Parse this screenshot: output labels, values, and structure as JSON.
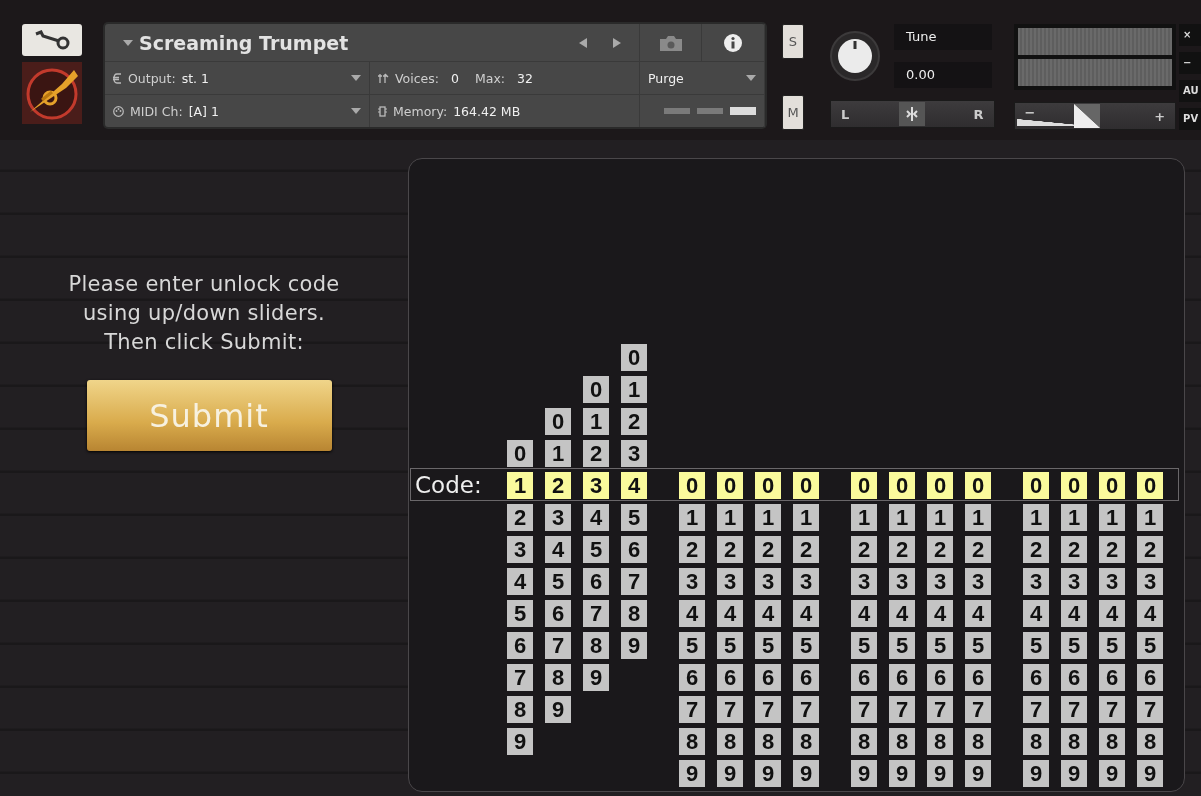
{
  "instrument": {
    "title": "Screaming Trumpet",
    "output_label": "Output:",
    "output_value": "st. 1",
    "voices_label": "Voices:",
    "voices_value": "0",
    "max_label": "Max:",
    "max_value": "32",
    "purge": "Purge",
    "midi_label": "MIDI Ch:",
    "midi_value": "[A] 1",
    "memory_label": "Memory:",
    "memory_value": "164.42 MB"
  },
  "solo_button": "S",
  "mute_button": "M",
  "tune": {
    "label": "Tune",
    "value": "0.00"
  },
  "pan": {
    "left": "L",
    "right": "R",
    "level": 0.5
  },
  "volume": {
    "minus": "−",
    "plus": "+",
    "level": 0.45
  },
  "side_buttons": [
    "×",
    "−",
    "AU",
    "PV"
  ],
  "unlock": {
    "instructions": "Please enter unlock code\nusing up/down sliders.\nThen click Submit:",
    "submit": "Submit"
  },
  "code": {
    "label": "Code:",
    "groups": [
      {
        "columns": [
          {
            "digits": [
              {
                "label": "0",
                "selected": false
              },
              {
                "label": "1",
                "selected": true
              },
              {
                "label": "2",
                "selected": false
              },
              {
                "label": "3",
                "selected": false
              },
              {
                "label": "4",
                "selected": false
              },
              {
                "label": "5",
                "selected": false
              },
              {
                "label": "6",
                "selected": false
              },
              {
                "label": "7",
                "selected": false
              },
              {
                "label": "8",
                "selected": false
              },
              {
                "label": "9",
                "selected": false
              }
            ]
          },
          {
            "digits": [
              {
                "label": "0",
                "selected": false
              },
              {
                "label": "1",
                "selected": false
              },
              {
                "label": "2",
                "selected": true
              },
              {
                "label": "3",
                "selected": false
              },
              {
                "label": "4",
                "selected": false
              },
              {
                "label": "5",
                "selected": false
              },
              {
                "label": "6",
                "selected": false
              },
              {
                "label": "7",
                "selected": false
              },
              {
                "label": "8",
                "selected": false
              },
              {
                "label": "9",
                "selected": false
              }
            ]
          },
          {
            "digits": [
              {
                "label": "0",
                "selected": false
              },
              {
                "label": "1",
                "selected": false
              },
              {
                "label": "2",
                "selected": false
              },
              {
                "label": "3",
                "selected": true
              },
              {
                "label": "4",
                "selected": false
              },
              {
                "label": "5",
                "selected": false
              },
              {
                "label": "6",
                "selected": false
              },
              {
                "label": "7",
                "selected": false
              },
              {
                "label": "8",
                "selected": false
              },
              {
                "label": "9",
                "selected": false
              }
            ]
          },
          {
            "digits": [
              {
                "label": "0",
                "selected": false
              },
              {
                "label": "1",
                "selected": false
              },
              {
                "label": "2",
                "selected": false
              },
              {
                "label": "3",
                "selected": false
              },
              {
                "label": "4",
                "selected": true
              },
              {
                "label": "5",
                "selected": false
              },
              {
                "label": "6",
                "selected": false
              },
              {
                "label": "7",
                "selected": false
              },
              {
                "label": "8",
                "selected": false
              },
              {
                "label": "9",
                "selected": false
              }
            ]
          }
        ]
      },
      {
        "columns": [
          {
            "digits": [
              {
                "label": "0",
                "selected": true
              },
              {
                "label": "1",
                "selected": false
              },
              {
                "label": "2",
                "selected": false
              },
              {
                "label": "3",
                "selected": false
              },
              {
                "label": "4",
                "selected": false
              },
              {
                "label": "5",
                "selected": false
              },
              {
                "label": "6",
                "selected": false
              },
              {
                "label": "7",
                "selected": false
              },
              {
                "label": "8",
                "selected": false
              },
              {
                "label": "9",
                "selected": false
              }
            ]
          },
          {
            "digits": [
              {
                "label": "0",
                "selected": true
              },
              {
                "label": "1",
                "selected": false
              },
              {
                "label": "2",
                "selected": false
              },
              {
                "label": "3",
                "selected": false
              },
              {
                "label": "4",
                "selected": false
              },
              {
                "label": "5",
                "selected": false
              },
              {
                "label": "6",
                "selected": false
              },
              {
                "label": "7",
                "selected": false
              },
              {
                "label": "8",
                "selected": false
              },
              {
                "label": "9",
                "selected": false
              }
            ]
          },
          {
            "digits": [
              {
                "label": "0",
                "selected": true
              },
              {
                "label": "1",
                "selected": false
              },
              {
                "label": "2",
                "selected": false
              },
              {
                "label": "3",
                "selected": false
              },
              {
                "label": "4",
                "selected": false
              },
              {
                "label": "5",
                "selected": false
              },
              {
                "label": "6",
                "selected": false
              },
              {
                "label": "7",
                "selected": false
              },
              {
                "label": "8",
                "selected": false
              },
              {
                "label": "9",
                "selected": false
              }
            ]
          },
          {
            "digits": [
              {
                "label": "0",
                "selected": true
              },
              {
                "label": "1",
                "selected": false
              },
              {
                "label": "2",
                "selected": false
              },
              {
                "label": "3",
                "selected": false
              },
              {
                "label": "4",
                "selected": false
              },
              {
                "label": "5",
                "selected": false
              },
              {
                "label": "6",
                "selected": false
              },
              {
                "label": "7",
                "selected": false
              },
              {
                "label": "8",
                "selected": false
              },
              {
                "label": "9",
                "selected": false
              }
            ]
          }
        ]
      },
      {
        "columns": [
          {
            "digits": [
              {
                "label": "0",
                "selected": true
              },
              {
                "label": "1",
                "selected": false
              },
              {
                "label": "2",
                "selected": false
              },
              {
                "label": "3",
                "selected": false
              },
              {
                "label": "4",
                "selected": false
              },
              {
                "label": "5",
                "selected": false
              },
              {
                "label": "6",
                "selected": false
              },
              {
                "label": "7",
                "selected": false
              },
              {
                "label": "8",
                "selected": false
              },
              {
                "label": "9",
                "selected": false
              }
            ]
          },
          {
            "digits": [
              {
                "label": "0",
                "selected": true
              },
              {
                "label": "1",
                "selected": false
              },
              {
                "label": "2",
                "selected": false
              },
              {
                "label": "3",
                "selected": false
              },
              {
                "label": "4",
                "selected": false
              },
              {
                "label": "5",
                "selected": false
              },
              {
                "label": "6",
                "selected": false
              },
              {
                "label": "7",
                "selected": false
              },
              {
                "label": "8",
                "selected": false
              },
              {
                "label": "9",
                "selected": false
              }
            ]
          },
          {
            "digits": [
              {
                "label": "0",
                "selected": true
              },
              {
                "label": "1",
                "selected": false
              },
              {
                "label": "2",
                "selected": false
              },
              {
                "label": "3",
                "selected": false
              },
              {
                "label": "4",
                "selected": false
              },
              {
                "label": "5",
                "selected": false
              },
              {
                "label": "6",
                "selected": false
              },
              {
                "label": "7",
                "selected": false
              },
              {
                "label": "8",
                "selected": false
              },
              {
                "label": "9",
                "selected": false
              }
            ]
          },
          {
            "digits": [
              {
                "label": "0",
                "selected": true
              },
              {
                "label": "1",
                "selected": false
              },
              {
                "label": "2",
                "selected": false
              },
              {
                "label": "3",
                "selected": false
              },
              {
                "label": "4",
                "selected": false
              },
              {
                "label": "5",
                "selected": false
              },
              {
                "label": "6",
                "selected": false
              },
              {
                "label": "7",
                "selected": false
              },
              {
                "label": "8",
                "selected": false
              },
              {
                "label": "9",
                "selected": false
              }
            ]
          }
        ]
      },
      {
        "columns": [
          {
            "digits": [
              {
                "label": "0",
                "selected": true
              },
              {
                "label": "1",
                "selected": false
              },
              {
                "label": "2",
                "selected": false
              },
              {
                "label": "3",
                "selected": false
              },
              {
                "label": "4",
                "selected": false
              },
              {
                "label": "5",
                "selected": false
              },
              {
                "label": "6",
                "selected": false
              },
              {
                "label": "7",
                "selected": false
              },
              {
                "label": "8",
                "selected": false
              },
              {
                "label": "9",
                "selected": false
              }
            ]
          },
          {
            "digits": [
              {
                "label": "0",
                "selected": true
              },
              {
                "label": "1",
                "selected": false
              },
              {
                "label": "2",
                "selected": false
              },
              {
                "label": "3",
                "selected": false
              },
              {
                "label": "4",
                "selected": false
              },
              {
                "label": "5",
                "selected": false
              },
              {
                "label": "6",
                "selected": false
              },
              {
                "label": "7",
                "selected": false
              },
              {
                "label": "8",
                "selected": false
              },
              {
                "label": "9",
                "selected": false
              }
            ]
          },
          {
            "digits": [
              {
                "label": "0",
                "selected": true
              },
              {
                "label": "1",
                "selected": false
              },
              {
                "label": "2",
                "selected": false
              },
              {
                "label": "3",
                "selected": false
              },
              {
                "label": "4",
                "selected": false
              },
              {
                "label": "5",
                "selected": false
              },
              {
                "label": "6",
                "selected": false
              },
              {
                "label": "7",
                "selected": false
              },
              {
                "label": "8",
                "selected": false
              },
              {
                "label": "9",
                "selected": false
              }
            ]
          },
          {
            "digits": [
              {
                "label": "0",
                "selected": true
              },
              {
                "label": "1",
                "selected": false
              },
              {
                "label": "2",
                "selected": false
              },
              {
                "label": "3",
                "selected": false
              },
              {
                "label": "4",
                "selected": false
              },
              {
                "label": "5",
                "selected": false
              },
              {
                "label": "6",
                "selected": false
              },
              {
                "label": "7",
                "selected": false
              },
              {
                "label": "8",
                "selected": false
              },
              {
                "label": "9",
                "selected": false
              }
            ]
          }
        ]
      }
    ]
  }
}
